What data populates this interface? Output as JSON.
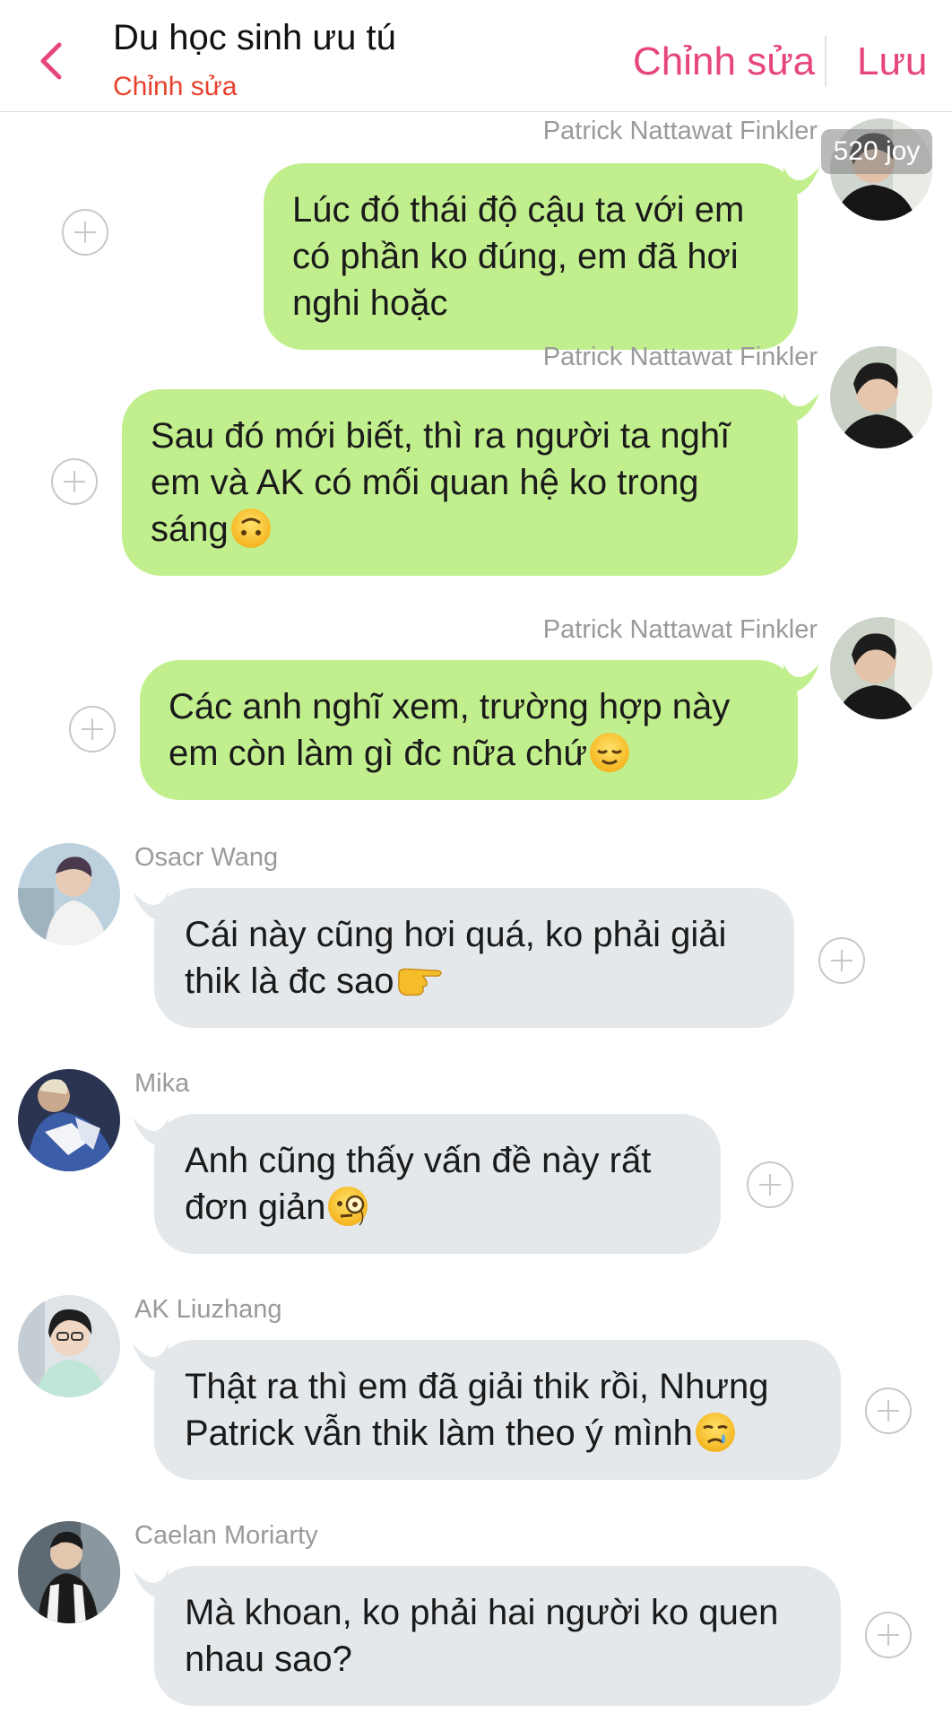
{
  "header": {
    "title": "Du học sinh ưu tú",
    "subtitle": "Chỉnh sửa",
    "edit_label": "Chỉnh sửa",
    "save_label": "Lưu"
  },
  "badge": "520 joy",
  "colors": {
    "accent": "#e6467c",
    "subtitle": "#e8412e",
    "bubble_outgoing": "#c2ef8e",
    "bubble_incoming": "#e4e8eb"
  },
  "messages": [
    {
      "sender": "Patrick Nattawat Finkler",
      "side": "right",
      "text": "Lúc đó thái độ cậu ta với em có phần ko đúng, em đã hơi nghi hoặc",
      "emoji": "",
      "avatar": "avatar-photo"
    },
    {
      "sender": "Patrick Nattawat Finkler",
      "side": "right",
      "text": "Sau đó mới biết, thì ra người ta nghĩ em và AK có mối quan hệ ko trong sáng",
      "emoji": "upside-down-face-emoji",
      "avatar": "avatar-photo"
    },
    {
      "sender": "Patrick Nattawat Finkler",
      "side": "right",
      "text": "Các anh nghĩ xem, trường hợp này em còn làm gì đc nữa chứ",
      "emoji": "relieved-face-emoji",
      "avatar": "avatar-photo"
    },
    {
      "sender": "Osacr Wang",
      "side": "left",
      "text": "Cái này cũng hơi quá, ko phải giải thik là đc sao",
      "emoji": "pointing-right-emoji",
      "avatar": "avatar-photo"
    },
    {
      "sender": "Mika",
      "side": "left",
      "text": "Anh cũng thấy vấn đề này rất đơn giản",
      "emoji": "monocle-face-emoji",
      "avatar": "avatar-photo"
    },
    {
      "sender": "AK Liuzhang",
      "side": "left",
      "text": "Thật ra thì em đã giải thik rồi, Nhưng Patrick vẫn thik làm theo ý mình",
      "emoji": "crying-face-emoji",
      "avatar": "avatar-photo"
    },
    {
      "sender": "Caelan Moriarty",
      "side": "left",
      "text": "Mà khoan, ko phải hai người ko quen nhau sao?",
      "emoji": "",
      "avatar": "avatar-photo"
    }
  ]
}
